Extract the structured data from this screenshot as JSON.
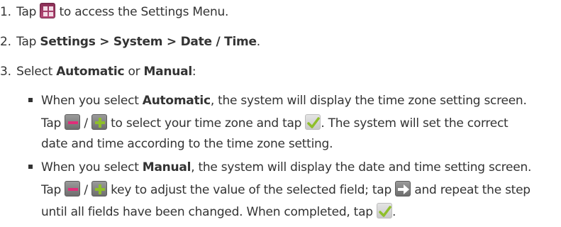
{
  "step1": {
    "number": "1.",
    "before_icon": "Tap",
    "after_icon": "to access the Settings Menu.",
    "icon": "grid-icon"
  },
  "step2": {
    "number": "2.",
    "text_tap": "Tap",
    "path": "Settings > System > Date / Time",
    "end": "."
  },
  "step3": {
    "number": "3.",
    "text_select": "Select",
    "opt_auto": "Automatic",
    "text_or": "or",
    "opt_manual": "Manual",
    "end": ":"
  },
  "bullet1": {
    "line1_pre": "When you select",
    "line1_bold": "Automatic",
    "line1_post": ", the system will display the time zone setting screen.",
    "line2_tap": "Tap",
    "line2_slash": "/",
    "line2_mid": "to select your time zone and tap",
    "line2_end": ". The system will set the correct",
    "line3": "date and time according to the time zone setting."
  },
  "bullet2": {
    "line1_pre": "When you select",
    "line1_bold": "Manual",
    "line1_post": ", the system will display the date and time setting screen.",
    "line2_tap": "Tap",
    "line2_slash": "/",
    "line2_mid": "key to adjust the value of the selected field; tap",
    "line2_end": "and repeat the step",
    "line3": "until all fields have been changed. When completed, tap",
    "line3_end": "."
  },
  "icons": {
    "grid": "grid-icon",
    "minus": "minus-icon",
    "plus": "plus-icon",
    "check": "checkmark-icon",
    "arrow": "arrow-right-icon"
  },
  "colors": {
    "text": "#333333",
    "grid_icon": "#a33e68",
    "minus_icon": "#e02d7a",
    "plus_icon": "#8fbf2a",
    "check_icon": "#8fbf2a"
  }
}
